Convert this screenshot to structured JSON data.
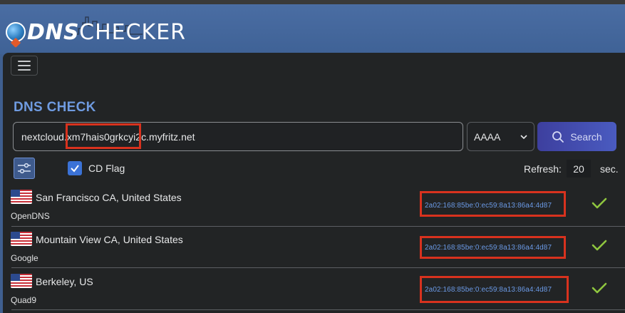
{
  "header": {
    "logo_dns": "DNS",
    "logo_checker": "CHECKER"
  },
  "page": {
    "title": "DNS CHECK"
  },
  "search": {
    "domain_value": "nextcloud.xm7hais0grkcyi2c.myfritz.net",
    "record_type": "AAAA",
    "button_label": "Search"
  },
  "options": {
    "cd_flag_label": "CD Flag",
    "cd_flag_checked": true,
    "refresh_label": "Refresh:",
    "refresh_value": "20",
    "refresh_unit": "sec."
  },
  "results": [
    {
      "location": "San Francisco CA, United States",
      "provider": "OpenDNS",
      "ip": "2a02:168:85be:0:ec59:8a13:86a4:4d87",
      "status": "check-icon"
    },
    {
      "location": "Mountain View CA, United States",
      "provider": "Google",
      "ip": "2a02:168:85be:0:ec59:8a13:86a4:4d87",
      "status": "check-icon"
    },
    {
      "location": "Berkeley, US",
      "provider": "Quad9",
      "ip": "2a02:168:85be:0:ec59:8a13:86a4:4d87",
      "status": "check-icon"
    }
  ],
  "colors": {
    "accent": "#6f9be0",
    "highlight_box": "#d8321e",
    "check": "#8fc63f"
  }
}
